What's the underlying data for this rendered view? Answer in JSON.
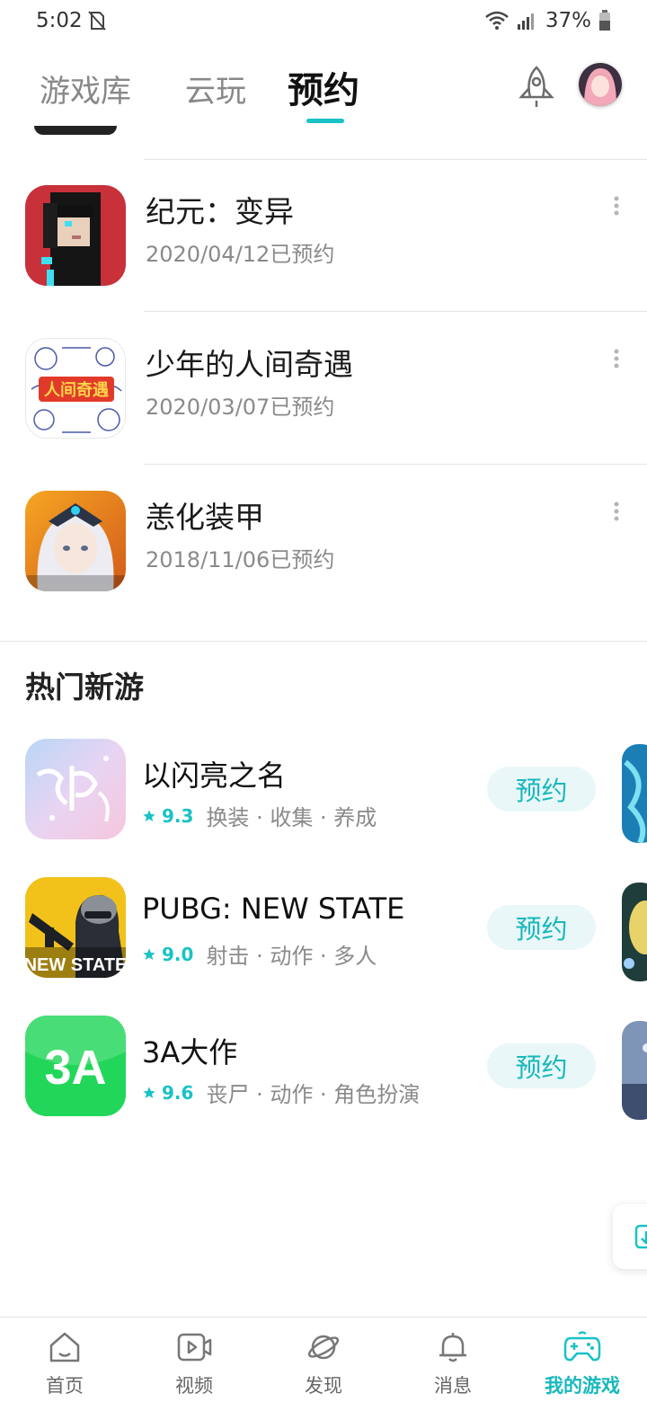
{
  "status_bar": {
    "time": "5:02",
    "battery": "37%"
  },
  "top_tabs": [
    {
      "label": "游戏库"
    },
    {
      "label": "云玩"
    },
    {
      "label": "预约"
    }
  ],
  "reservations": [
    {
      "title": "纪元：变异",
      "date": "2020/04/12已预约"
    },
    {
      "title": "少年的人间奇遇",
      "date": "2020/03/07已预约",
      "icon_text": "人间奇遇"
    },
    {
      "title": "恙化装甲",
      "date": "2018/11/06已预约"
    }
  ],
  "hot_section": {
    "title": "热门新游"
  },
  "hot_games": [
    {
      "title": "以闪亮之名",
      "rating": "9.3",
      "tags": "换装 · 收集 · 养成",
      "button": "预约"
    },
    {
      "title": "PUBG: NEW STATE",
      "rating": "9.0",
      "tags": "射击 · 动作 · 多人",
      "button": "预约",
      "icon_text": "NEW STATE"
    },
    {
      "title": "3A大作",
      "rating": "9.6",
      "tags": "丧尸 · 动作 · 角色扮演",
      "button": "预约",
      "icon_text": "3A"
    }
  ],
  "bottom_nav": [
    {
      "label": "首页"
    },
    {
      "label": "视频"
    },
    {
      "label": "发现"
    },
    {
      "label": "消息"
    },
    {
      "label": "我的游戏"
    }
  ],
  "colors": {
    "accent": "#18c2c6",
    "accent_bg": "#e9f7f8"
  }
}
